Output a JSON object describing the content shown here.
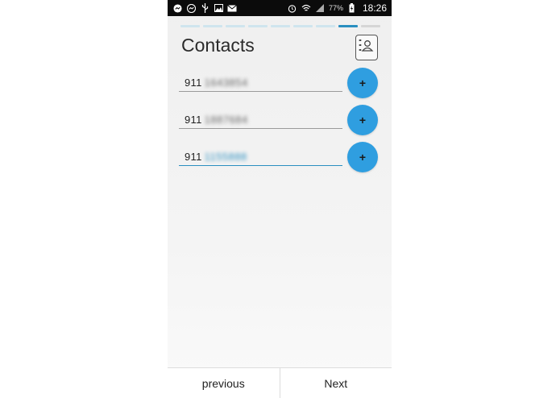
{
  "status_bar": {
    "icons_left": [
      "messenger-icon",
      "messenger-icon",
      "usb-icon",
      "gallery-icon",
      "email-icon"
    ],
    "icons_right": [
      "alarm-icon",
      "wifi-icon",
      "signal-icon",
      "battery-charging-icon"
    ],
    "battery": "77%",
    "time": "18:26"
  },
  "progress": {
    "total_steps": 9,
    "current_step": 8
  },
  "header": {
    "title": "Contacts"
  },
  "contacts": [
    {
      "prefix": "911",
      "obscured": "1643854",
      "focused": false
    },
    {
      "prefix": "911",
      "obscured": "1887684",
      "focused": false
    },
    {
      "prefix": "911",
      "obscured": "1155888",
      "focused": true
    }
  ],
  "add_label": "+",
  "footer": {
    "previous": "previous",
    "next": "Next"
  },
  "colors": {
    "accent": "#2f9ee0",
    "progress_active": "#2a8fc0"
  }
}
